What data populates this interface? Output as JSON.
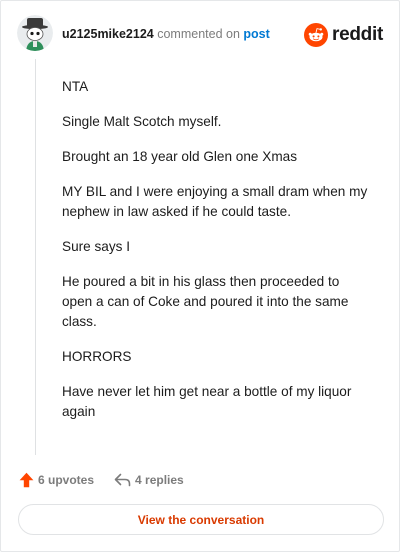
{
  "header": {
    "username": "u2125mike2124",
    "commented_on": "commented on",
    "post_link": "post",
    "brand": "reddit",
    "avatar_icon": "avatar-icon",
    "brand_icon": "reddit-snoo-icon"
  },
  "comment": {
    "paragraphs": [
      "NTA",
      "Single Malt Scotch myself.",
      "Brought an 18 year old Glen one Xmas",
      "MY BIL and I were enjoying a small dram when my nephew in law asked if he could taste.",
      "Sure says I",
      "He poured a bit in his glass then proceeded to open a can of Coke and poured it into the same class.",
      "HORRORS",
      "Have never let him get near a bottle of my liquor again"
    ]
  },
  "actions": {
    "upvotes": "6 upvotes",
    "replies": "4 replies",
    "upvote_icon": "upvote-arrow-icon",
    "reply_icon": "reply-arrow-icon"
  },
  "cta": {
    "label": "View the conversation"
  },
  "colors": {
    "accent": "#d93a00",
    "brand_orange": "#ff4500",
    "link": "#0079d3",
    "muted": "#7c7c7c"
  }
}
